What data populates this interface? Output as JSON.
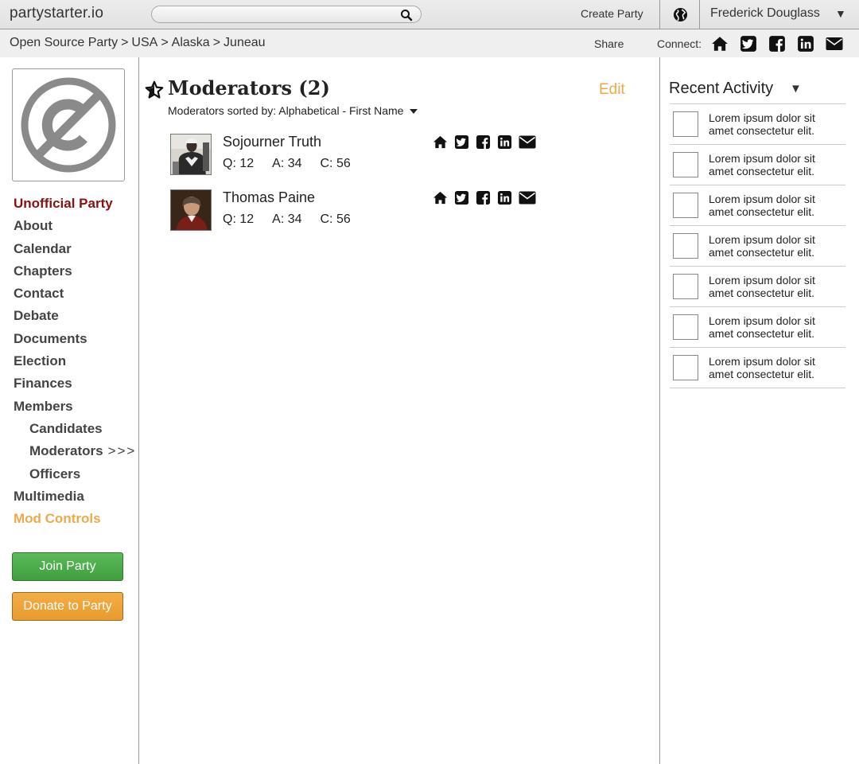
{
  "header": {
    "logo": "partystarter.io",
    "search_placeholder": "",
    "create_party": "Create Party",
    "user_name": "Frederick Douglass",
    "user_caret": "▼"
  },
  "breadcrumb": {
    "items": [
      "Open Source Party",
      "USA",
      "Alaska",
      "Juneau"
    ],
    "share": "Share",
    "connect": "Connect:"
  },
  "sidebar": {
    "items": [
      {
        "label": "Unofficial Party"
      },
      {
        "label": "About"
      },
      {
        "label": "Calendar"
      },
      {
        "label": "Chapters"
      },
      {
        "label": "Contact"
      },
      {
        "label": "Debate"
      },
      {
        "label": "Documents"
      },
      {
        "label": "Election"
      },
      {
        "label": "Finances"
      },
      {
        "label": "Members"
      },
      {
        "label": "Candidates"
      },
      {
        "label": "Moderators",
        "marker": ">>>"
      },
      {
        "label": "Officers"
      },
      {
        "label": "Multimedia"
      },
      {
        "label": "Mod Controls"
      }
    ],
    "join_button": "Join Party",
    "donate_button": "Donate to Party"
  },
  "main": {
    "title": "Moderators (2)",
    "edit": "Edit",
    "sort_label": "Moderators sorted by: Alphabetical - First Name",
    "moderators": [
      {
        "name": "Sojourner Truth",
        "q": "Q: 12",
        "a": "A: 34",
        "c": "C: 56"
      },
      {
        "name": "Thomas Paine",
        "q": "Q: 12",
        "a": "A: 34",
        "c": "C: 56"
      }
    ]
  },
  "recent_activity": {
    "title": "Recent Activity",
    "caret": "▼",
    "items": [
      {
        "text": "Lorem ipsum dolor sit amet consectetur elit."
      },
      {
        "text": "Lorem ipsum dolor sit amet consectetur elit."
      },
      {
        "text": "Lorem ipsum dolor sit amet consectetur elit."
      },
      {
        "text": "Lorem ipsum dolor sit amet consectetur elit."
      },
      {
        "text": "Lorem ipsum dolor sit amet consectetur elit."
      },
      {
        "text": "Lorem ipsum dolor sit amet consectetur elit."
      },
      {
        "text": "Lorem ipsum dolor sit amet consectetur elit."
      }
    ]
  },
  "colors": {
    "accent_orange": "#f0a94a",
    "party_red": "#8b1010",
    "join_green": "#4caf50",
    "donate_orange": "#efa33a"
  },
  "icons": [
    "search-icon",
    "globe-icon",
    "home-icon",
    "twitter-icon",
    "facebook-icon",
    "linkedin-icon",
    "email-icon",
    "star-icon",
    "public-domain-logo"
  ]
}
